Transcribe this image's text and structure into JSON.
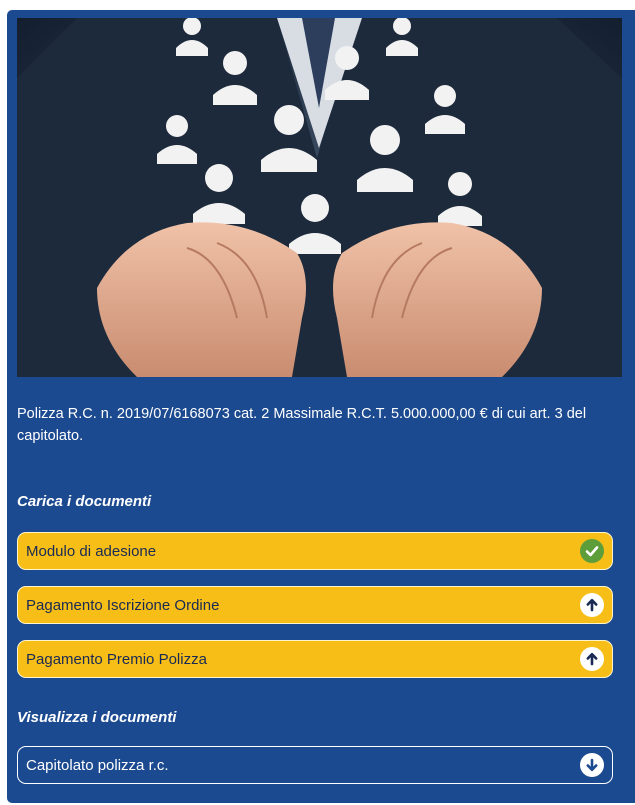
{
  "hero": {
    "icon": "hands-holding-people-icon"
  },
  "description": "Polizza R.C. n. 2019/07/6168073 cat. 2 Massimale R.C.T. 5.000.000,00 € di cui art. 3 del capitolato.",
  "upload_section": {
    "title": "Carica i documenti",
    "items": [
      {
        "label": "Modulo di adesione",
        "status_icon": "check-circle-icon",
        "status_color": "#5e9e3a"
      },
      {
        "label": "Pagamento Iscrizione Ordine",
        "status_icon": "arrow-up-circle-icon"
      },
      {
        "label": "Pagamento Premio Polizza",
        "status_icon": "arrow-up-circle-icon"
      }
    ]
  },
  "view_section": {
    "title": "Visualizza i documenti",
    "items": [
      {
        "label": "Capitolato polizza r.c.",
        "status_icon": "arrow-down-circle-icon"
      }
    ]
  },
  "colors": {
    "panel_bg": "#1c4a90",
    "upload_bg": "#f6be16",
    "upload_text": "#1a2a55",
    "text": "#ffffff"
  }
}
